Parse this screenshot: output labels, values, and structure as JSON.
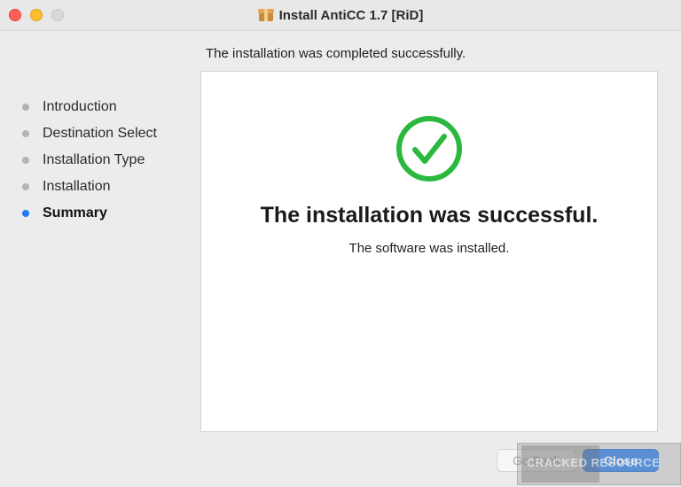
{
  "window": {
    "title": "Install AntiCC 1.7 [RiD]",
    "title_icon": "package-icon"
  },
  "header": {
    "status_text": "The installation was completed successfully."
  },
  "sidebar": {
    "steps": [
      {
        "label": "Introduction",
        "active": false
      },
      {
        "label": "Destination Select",
        "active": false
      },
      {
        "label": "Installation Type",
        "active": false
      },
      {
        "label": "Installation",
        "active": false
      },
      {
        "label": "Summary",
        "active": true
      }
    ]
  },
  "main": {
    "icon": "checkmark-circle-icon",
    "success_title": "The installation was successful.",
    "success_subtitle": "The software was installed."
  },
  "footer": {
    "back_label": "Go Back",
    "close_label": "Close"
  },
  "watermark": {
    "text": "CRACKED RESOURCE"
  },
  "colors": {
    "accent": "#3d8cf5",
    "active_dot": "#1e7cf2",
    "success_green": "#2ab83f",
    "close_traffic": "#ff5f57",
    "minimize_traffic": "#febc2e"
  }
}
